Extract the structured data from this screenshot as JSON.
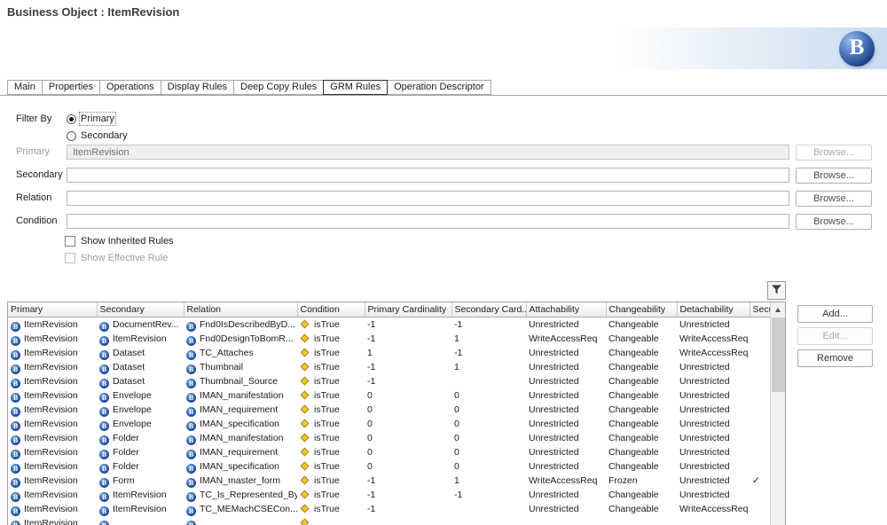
{
  "window": {
    "title": "Business Object : ItemRevision"
  },
  "logo": {
    "letter": "B"
  },
  "tabs": [
    {
      "label": "Main",
      "selected": false
    },
    {
      "label": "Properties",
      "selected": false
    },
    {
      "label": "Operations",
      "selected": false
    },
    {
      "label": "Display Rules",
      "selected": false
    },
    {
      "label": "Deep Copy Rules",
      "selected": false
    },
    {
      "label": "GRM Rules",
      "selected": true
    },
    {
      "label": "Operation Descriptor",
      "selected": false
    }
  ],
  "filter_by": {
    "label": "Filter By",
    "options": [
      {
        "label": "Primary",
        "selected": true
      },
      {
        "label": "Secondary",
        "selected": false
      }
    ]
  },
  "form": {
    "browse_label": "Browse...",
    "fields": [
      {
        "label": "Primary",
        "value": "ItemRevision",
        "disabled": true
      },
      {
        "label": "Secondary",
        "value": "",
        "disabled": false
      },
      {
        "label": "Relation",
        "value": "",
        "disabled": false
      },
      {
        "label": "Condition",
        "value": "",
        "disabled": false
      }
    ],
    "checkboxes": [
      {
        "label": "Show Inherited Rules",
        "checked": false,
        "disabled": false
      },
      {
        "label": "Show Effective Rule",
        "checked": false,
        "disabled": true
      }
    ]
  },
  "rules_table": {
    "columns": [
      "Primary",
      "Secondary",
      "Relation",
      "Condition",
      "Primary Cardinality",
      "Secondary Card...",
      "Attachability",
      "Changeability",
      "Detachability",
      "Secur"
    ],
    "rows": [
      {
        "primary": "ItemRevision",
        "secondary": "DocumentRev...",
        "relation": "Fnd0IsDescribedByD...",
        "condition": "isTrue",
        "primary_cardinality": "-1",
        "secondary_cardinality": "-1",
        "attachability": "Unrestricted",
        "changeability": "Changeable",
        "detachability": "Unrestricted",
        "secur": ""
      },
      {
        "primary": "ItemRevision",
        "secondary": "ItemRevision",
        "relation": "Fnd0DesignToBomR...",
        "condition": "isTrue",
        "primary_cardinality": "-1",
        "secondary_cardinality": "1",
        "attachability": "WriteAccessReq",
        "changeability": "Changeable",
        "detachability": "WriteAccessReq",
        "secur": ""
      },
      {
        "primary": "ItemRevision",
        "secondary": "Dataset",
        "relation": "TC_Attaches",
        "condition": "isTrue",
        "primary_cardinality": "1",
        "secondary_cardinality": "-1",
        "attachability": "Unrestricted",
        "changeability": "Changeable",
        "detachability": "WriteAccessReq",
        "secur": ""
      },
      {
        "primary": "ItemRevision",
        "secondary": "Dataset",
        "relation": "Thumbnail",
        "condition": "isTrue",
        "primary_cardinality": "-1",
        "secondary_cardinality": "1",
        "attachability": "Unrestricted",
        "changeability": "Changeable",
        "detachability": "Unrestricted",
        "secur": ""
      },
      {
        "primary": "ItemRevision",
        "secondary": "Dataset",
        "relation": "Thumbnail_Source",
        "condition": "isTrue",
        "primary_cardinality": "-1",
        "secondary_cardinality": "",
        "attachability": "Unrestricted",
        "changeability": "Changeable",
        "detachability": "Unrestricted",
        "secur": ""
      },
      {
        "primary": "ItemRevision",
        "secondary": "Envelope",
        "relation": "IMAN_manifestation",
        "condition": "isTrue",
        "primary_cardinality": "0",
        "secondary_cardinality": "0",
        "attachability": "Unrestricted",
        "changeability": "Changeable",
        "detachability": "Unrestricted",
        "secur": ""
      },
      {
        "primary": "ItemRevision",
        "secondary": "Envelope",
        "relation": "IMAN_requirement",
        "condition": "isTrue",
        "primary_cardinality": "0",
        "secondary_cardinality": "0",
        "attachability": "Unrestricted",
        "changeability": "Changeable",
        "detachability": "Unrestricted",
        "secur": ""
      },
      {
        "primary": "ItemRevision",
        "secondary": "Envelope",
        "relation": "IMAN_specification",
        "condition": "isTrue",
        "primary_cardinality": "0",
        "secondary_cardinality": "0",
        "attachability": "Unrestricted",
        "changeability": "Changeable",
        "detachability": "Unrestricted",
        "secur": ""
      },
      {
        "primary": "ItemRevision",
        "secondary": "Folder",
        "relation": "IMAN_manifestation",
        "condition": "isTrue",
        "primary_cardinality": "0",
        "secondary_cardinality": "0",
        "attachability": "Unrestricted",
        "changeability": "Changeable",
        "detachability": "Unrestricted",
        "secur": ""
      },
      {
        "primary": "ItemRevision",
        "secondary": "Folder",
        "relation": "IMAN_requirement",
        "condition": "isTrue",
        "primary_cardinality": "0",
        "secondary_cardinality": "0",
        "attachability": "Unrestricted",
        "changeability": "Changeable",
        "detachability": "Unrestricted",
        "secur": ""
      },
      {
        "primary": "ItemRevision",
        "secondary": "Folder",
        "relation": "IMAN_specification",
        "condition": "isTrue",
        "primary_cardinality": "0",
        "secondary_cardinality": "0",
        "attachability": "Unrestricted",
        "changeability": "Changeable",
        "detachability": "Unrestricted",
        "secur": ""
      },
      {
        "primary": "ItemRevision",
        "secondary": "Form",
        "relation": "IMAN_master_form",
        "condition": "isTrue",
        "primary_cardinality": "-1",
        "secondary_cardinality": "1",
        "attachability": "WriteAccessReq",
        "changeability": "Frozen",
        "detachability": "Unrestricted",
        "secur": "✓"
      },
      {
        "primary": "ItemRevision",
        "secondary": "ItemRevision",
        "relation": "TC_Is_Represented_By",
        "condition": "isTrue",
        "primary_cardinality": "-1",
        "secondary_cardinality": "-1",
        "attachability": "Unrestricted",
        "changeability": "Changeable",
        "detachability": "Unrestricted",
        "secur": ""
      },
      {
        "primary": "ItemRevision",
        "secondary": "ItemRevision",
        "relation": "TC_MEMachCSECon...",
        "condition": "isTrue",
        "primary_cardinality": "-1",
        "secondary_cardinality": "",
        "attachability": "Unrestricted",
        "changeability": "Changeable",
        "detachability": "WriteAccessReq",
        "secur": ""
      },
      {
        "primary": "ItemRevision",
        "secondary": "",
        "relation": "",
        "condition": "",
        "primary_cardinality": "",
        "secondary_cardinality": "",
        "attachability": "",
        "changeability": "",
        "detachability": "",
        "secur": ""
      }
    ]
  },
  "actions": [
    {
      "label": "Add...",
      "disabled": false
    },
    {
      "label": "Edit...",
      "disabled": true
    },
    {
      "label": "Remove",
      "disabled": false
    }
  ]
}
